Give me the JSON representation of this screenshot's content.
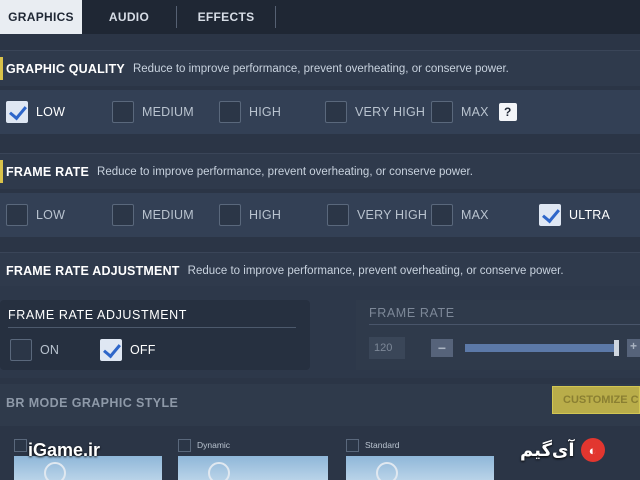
{
  "tabs": [
    {
      "label": "GRAPHICS",
      "active": true
    },
    {
      "label": "AUDIO",
      "active": false
    },
    {
      "label": "EFFECTS",
      "active": false
    }
  ],
  "graphic_quality": {
    "title": "GRAPHIC QUALITY",
    "desc": "Reduce to improve performance, prevent overheating, or conserve power.",
    "options": [
      {
        "label": "LOW",
        "checked": true
      },
      {
        "label": "MEDIUM",
        "checked": false
      },
      {
        "label": "HIGH",
        "checked": false
      },
      {
        "label": "VERY HIGH",
        "checked": false
      },
      {
        "label": "MAX",
        "checked": false
      }
    ],
    "help": "?"
  },
  "frame_rate": {
    "title": "FRAME RATE",
    "desc": "Reduce to improve performance, prevent overheating, or conserve power.",
    "options": [
      {
        "label": "LOW",
        "checked": false
      },
      {
        "label": "MEDIUM",
        "checked": false
      },
      {
        "label": "HIGH",
        "checked": false
      },
      {
        "label": "VERY HIGH",
        "checked": false
      },
      {
        "label": "MAX",
        "checked": false
      },
      {
        "label": "ULTRA",
        "checked": true
      }
    ]
  },
  "frame_rate_adjustment": {
    "title": "FRAME RATE ADJUSTMENT",
    "desc": "Reduce to improve performance, prevent overheating, or conserve power.",
    "panel_title": "FRAME RATE ADJUSTMENT",
    "options": [
      {
        "label": "ON",
        "checked": false
      },
      {
        "label": "OFF",
        "checked": true
      }
    ],
    "rate_panel": {
      "title": "FRAME RATE",
      "value": "120",
      "minus": "−",
      "plus": "+",
      "slider_level": 0.98
    }
  },
  "br_mode": {
    "title": "BR MODE GRAPHIC STYLE",
    "customize_label": "CUSTOMIZE CO",
    "styles": [
      {
        "name": "Dynamic"
      },
      {
        "name": "Standard"
      }
    ]
  },
  "watermark": {
    "left": "iGame.ir",
    "right": "آی‌گیم"
  },
  "colors": {
    "accent": "#d9c24a",
    "check": "#2e66c9",
    "background": "#2b3546"
  }
}
